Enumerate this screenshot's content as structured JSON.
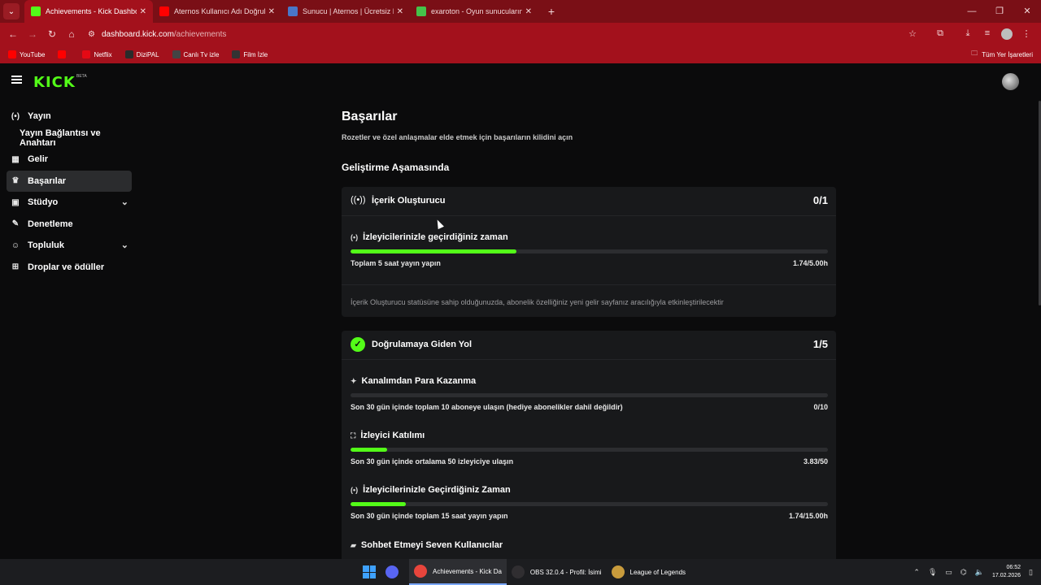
{
  "browser": {
    "tabs": [
      {
        "label": "Achievements - Kick Dashboard",
        "active": true,
        "favicon": "kick-icon",
        "color": "#53fc18"
      },
      {
        "label": "Aternos Kullanıcı Adı Doğrulama",
        "active": false,
        "favicon": "youtube-icon",
        "color": "#ff0000"
      },
      {
        "label": "Sunucu | Aternos | Ücretsiz Min",
        "active": false,
        "favicon": "aternos-icon",
        "color": "#4a76c8"
      },
      {
        "label": "exaroton - Oyun sunucularında",
        "active": false,
        "favicon": "exaroton-icon",
        "color": "#46c24a"
      }
    ],
    "new_tab": "+",
    "url_host": "dashboard.kick.com",
    "url_path": "/achievements",
    "bookmarks": [
      {
        "label": "YouTube",
        "icon": "youtube-icon",
        "color": "#ff0000"
      },
      {
        "label": "",
        "icon": "youtube-icon",
        "color": "#ff0000"
      },
      {
        "label": "Netflix",
        "icon": "netflix-icon",
        "color": "#e50914"
      },
      {
        "label": "DiziPAL",
        "icon": "dizipal-icon",
        "color": "#2b2b2b"
      },
      {
        "label": "Canlı Tv izle",
        "icon": "tv-icon",
        "color": "#444444"
      },
      {
        "label": "Film İzle",
        "icon": "film-icon",
        "color": "#333333"
      }
    ],
    "bookmarks_right": "Tüm Yer İşaretleri"
  },
  "app": {
    "logo": "KICK",
    "logo_beta": "BETA"
  },
  "sidebar": {
    "items": [
      {
        "label": "Yayın",
        "icon": "broadcast-icon",
        "glyph": "(•)",
        "active": false,
        "sub": false,
        "chevron": false
      },
      {
        "label": "Yayın Bağlantısı ve Anahtarı",
        "icon": "",
        "glyph": "",
        "active": false,
        "sub": true,
        "chevron": false
      },
      {
        "label": "Gelir",
        "icon": "revenue-icon",
        "glyph": "▦",
        "active": false,
        "sub": false,
        "chevron": false
      },
      {
        "label": "Başarılar",
        "icon": "trophy-icon",
        "glyph": "♛",
        "active": true,
        "sub": false,
        "chevron": false
      },
      {
        "label": "Stüdyo",
        "icon": "studio-icon",
        "glyph": "▣",
        "active": false,
        "sub": false,
        "chevron": true
      },
      {
        "label": "Denetleme",
        "icon": "wrench-icon",
        "glyph": "✎",
        "active": false,
        "sub": false,
        "chevron": false
      },
      {
        "label": "Topluluk",
        "icon": "community-icon",
        "glyph": "☺",
        "active": false,
        "sub": false,
        "chevron": true
      },
      {
        "label": "Droplar ve ödüller",
        "icon": "gift-icon",
        "glyph": "⊞",
        "active": false,
        "sub": false,
        "chevron": false
      }
    ]
  },
  "main": {
    "title": "Başarılar",
    "subtitle": "Rozetler ve özel anlaşmalar elde etmek için başarıların kilidini açın",
    "section_title": "Geliştirme Aşamasında",
    "cards": [
      {
        "title": "İçerik Oluşturucu",
        "count": "0/1",
        "icon": "broadcast-icon",
        "tasks": [
          {
            "title": "İzleyicilerinizle geçirdiğiniz zaman",
            "icon": "broadcast-icon",
            "desc": "Toplam 5 saat yayın yapın",
            "value": "1.74/5.00h",
            "progress": 0.348
          }
        ],
        "note": "İçerik Oluşturucu statüsüne sahip olduğunuzda, abonelik özelliğiniz yeni gelir sayfanız aracılığıyla etkinleştirilecektir"
      },
      {
        "title": "Doğrulamaya Giden Yol",
        "count": "1/5",
        "icon": "verified-check-icon",
        "tasks": [
          {
            "title": "Kanalımdan Para Kazanma",
            "icon": "sparkle-icon",
            "desc": "Son 30 gün içinde toplam 10 aboneye ulaşın (hediye abonelikler dahil değildir)",
            "value": "0/10",
            "progress": 0.0
          },
          {
            "title": "İzleyici Katılımı",
            "icon": "viewers-icon",
            "desc": "Son 30 gün içinde ortalama 50 izleyiciye ulaşın",
            "value": "3.83/50",
            "progress": 0.0766
          },
          {
            "title": "İzleyicilerinizle Geçirdiğiniz Zaman",
            "icon": "broadcast-icon",
            "desc": "Son 30 gün içinde toplam 15 saat yayın yapın",
            "value": "1.74/15.00h",
            "progress": 0.116
          },
          {
            "title": "Sohbet Etmeyi Seven Kullanıcılar",
            "icon": "chat-icon",
            "desc": "",
            "value": "",
            "progress": null
          }
        ]
      }
    ]
  },
  "taskbar": {
    "items": [
      {
        "label": "",
        "icon": "windows-start-icon",
        "color": "#3ea1ff"
      },
      {
        "label": "",
        "icon": "discord-icon",
        "color": "#5865f2"
      },
      {
        "label": "Achievements - Kick Da",
        "icon": "chrome-icon",
        "color": "#e8453c",
        "active": true
      },
      {
        "label": "OBS 32.0.4 - Profil: İsimi",
        "icon": "obs-icon",
        "color": "#302e31"
      },
      {
        "label": "League of Legends",
        "icon": "league-icon",
        "color": "#c89b3c"
      }
    ],
    "time": "06:52",
    "date": "17.02.2026"
  },
  "colors": {
    "accent": "#53fc18",
    "chrome": "#a3111c"
  }
}
